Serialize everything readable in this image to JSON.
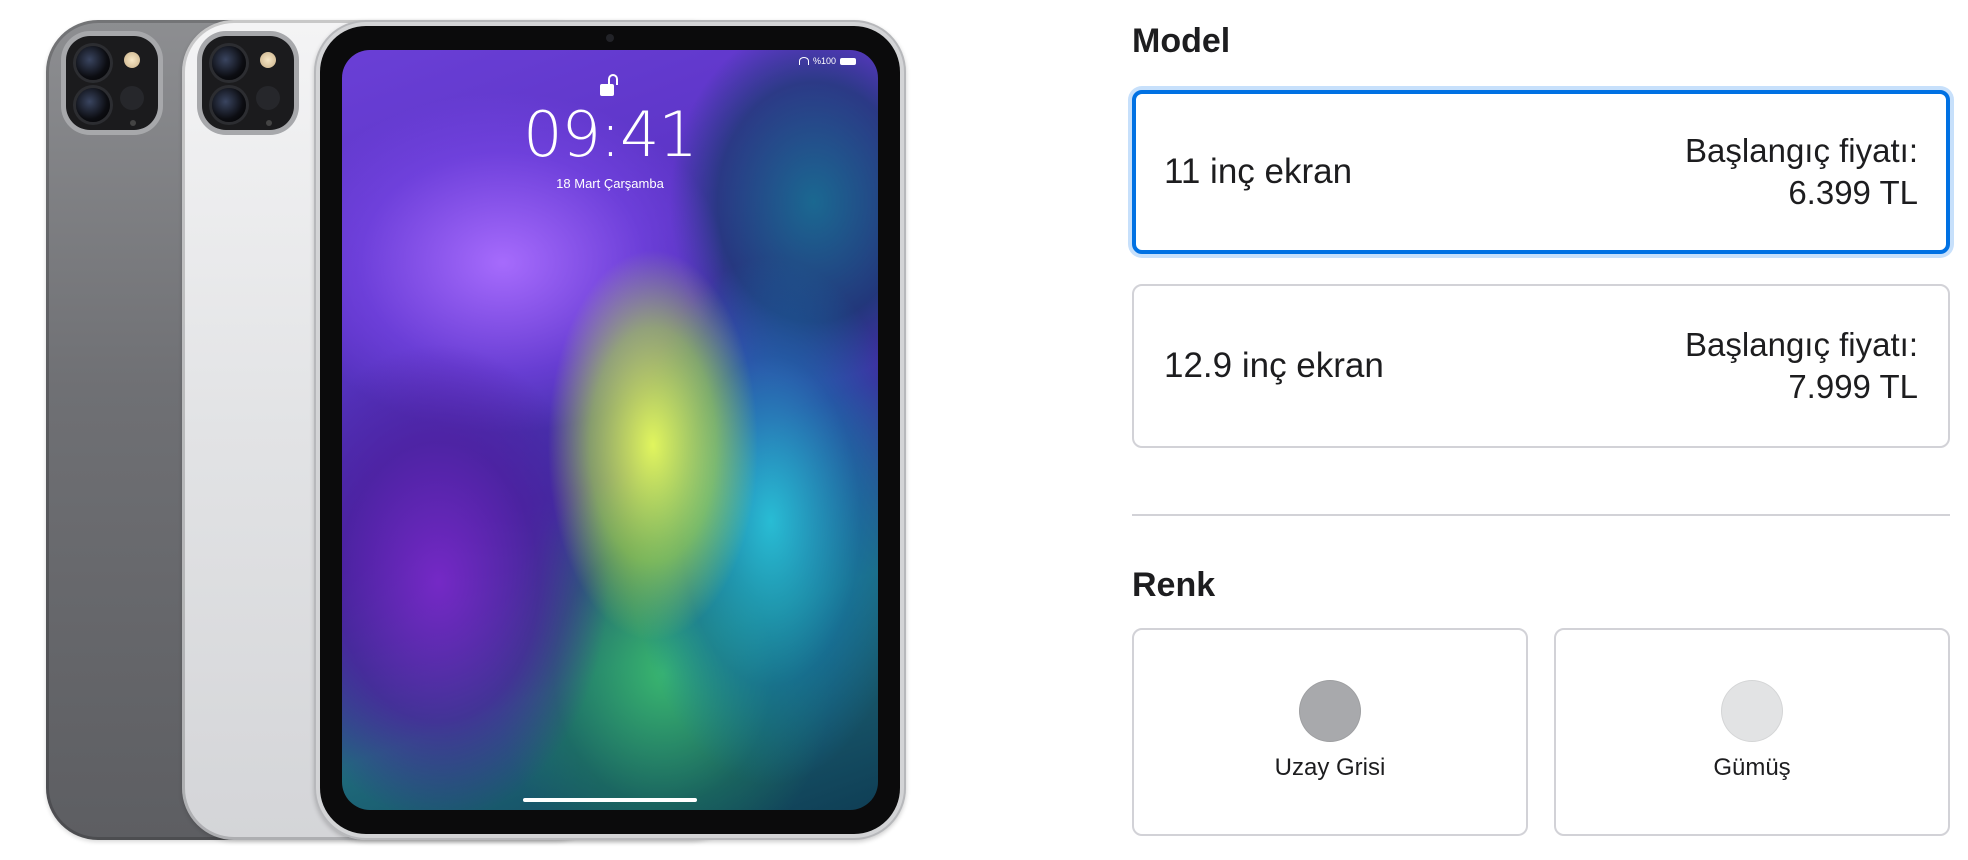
{
  "lock_screen": {
    "time": "09:41",
    "date": "18 Mart Çarşamba",
    "battery_label": "%100"
  },
  "model_section": {
    "heading": "Model",
    "options": [
      {
        "name": "11 inç ekran",
        "price_label": "Başlangıç fiyatı:",
        "price": "6.399 TL",
        "selected": true
      },
      {
        "name": "12.9 inç ekran",
        "price_label": "Başlangıç fiyatı:",
        "price": "7.999 TL",
        "selected": false
      }
    ]
  },
  "color_section": {
    "heading": "Renk",
    "options": [
      {
        "name": "Uzay Grisi",
        "swatch_color": "#a8a9ac"
      },
      {
        "name": "Gümüş",
        "swatch_color": "#e2e3e4"
      }
    ]
  },
  "colors": {
    "accent": "#0071e3",
    "focus_ring": "#c7e0fb",
    "border": "#d2d2d7",
    "text": "#1d1d1f"
  }
}
